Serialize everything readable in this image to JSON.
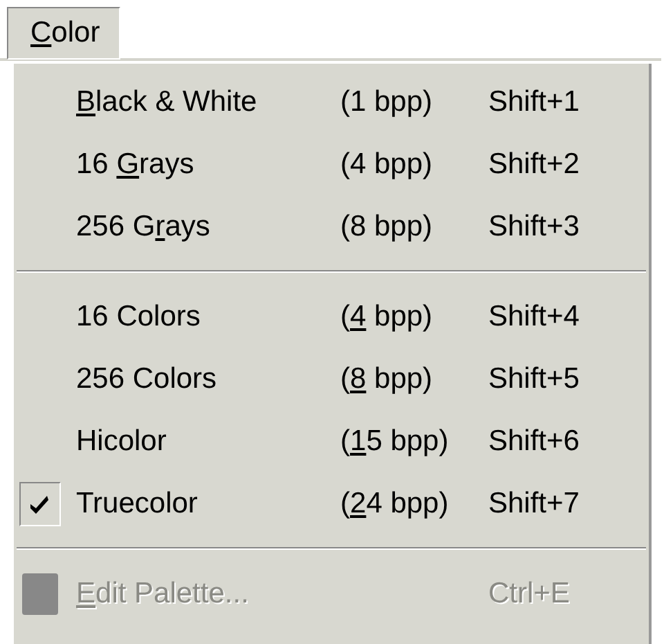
{
  "menu_bar": [
    {
      "label": [
        {
          "text": "C",
          "underlined": true
        },
        {
          "text": "olor",
          "underlined": false
        }
      ],
      "selected": true
    }
  ],
  "menu": {
    "groups": [
      [
        {
          "label": [
            {
              "text": "B",
              "underlined": true
            },
            {
              "text": "lack & White",
              "underlined": false
            }
          ],
          "depth": [
            {
              "text": "(1 bpp)",
              "underlined": false
            }
          ],
          "shortcut": "Shift+1",
          "checked": false,
          "disabled": false,
          "has_icon": false
        },
        {
          "label": [
            {
              "text": "16 ",
              "underlined": false
            },
            {
              "text": "G",
              "underlined": true
            },
            {
              "text": "rays",
              "underlined": false
            }
          ],
          "depth": [
            {
              "text": "(4 bpp)",
              "underlined": false
            }
          ],
          "shortcut": "Shift+2",
          "checked": false,
          "disabled": false,
          "has_icon": false
        },
        {
          "label": [
            {
              "text": "256 G",
              "underlined": false
            },
            {
              "text": "r",
              "underlined": true
            },
            {
              "text": "ays",
              "underlined": false
            }
          ],
          "depth": [
            {
              "text": "(8 bpp)",
              "underlined": false
            }
          ],
          "shortcut": "Shift+3",
          "checked": false,
          "disabled": false,
          "has_icon": false
        }
      ],
      [
        {
          "label": [
            {
              "text": "16 Colors",
              "underlined": false
            }
          ],
          "depth": [
            {
              "text": "(",
              "underlined": false
            },
            {
              "text": "4",
              "underlined": true
            },
            {
              "text": " bpp)",
              "underlined": false
            }
          ],
          "shortcut": "Shift+4",
          "checked": false,
          "disabled": false,
          "has_icon": false
        },
        {
          "label": [
            {
              "text": "256 Colors",
              "underlined": false
            }
          ],
          "depth": [
            {
              "text": "(",
              "underlined": false
            },
            {
              "text": "8",
              "underlined": true
            },
            {
              "text": " bpp)",
              "underlined": false
            }
          ],
          "shortcut": "Shift+5",
          "checked": false,
          "disabled": false,
          "has_icon": false
        },
        {
          "label": [
            {
              "text": "Hicolor",
              "underlined": false
            }
          ],
          "depth": [
            {
              "text": "(",
              "underlined": false
            },
            {
              "text": "1",
              "underlined": true
            },
            {
              "text": "5 bpp)",
              "underlined": false
            }
          ],
          "shortcut": "Shift+6",
          "checked": false,
          "disabled": false,
          "has_icon": false
        },
        {
          "label": [
            {
              "text": "Truecolor",
              "underlined": false
            }
          ],
          "depth": [
            {
              "text": "(",
              "underlined": false
            },
            {
              "text": "2",
              "underlined": true
            },
            {
              "text": "4 bpp)",
              "underlined": false
            }
          ],
          "shortcut": "Shift+7",
          "checked": true,
          "disabled": false,
          "has_icon": false
        }
      ],
      [
        {
          "label": [
            {
              "text": "E",
              "underlined": true
            },
            {
              "text": "dit Palette...",
              "underlined": false
            }
          ],
          "shortcut": "Ctrl+E",
          "checked": false,
          "disabled": true,
          "has_icon": true
        }
      ]
    ]
  }
}
